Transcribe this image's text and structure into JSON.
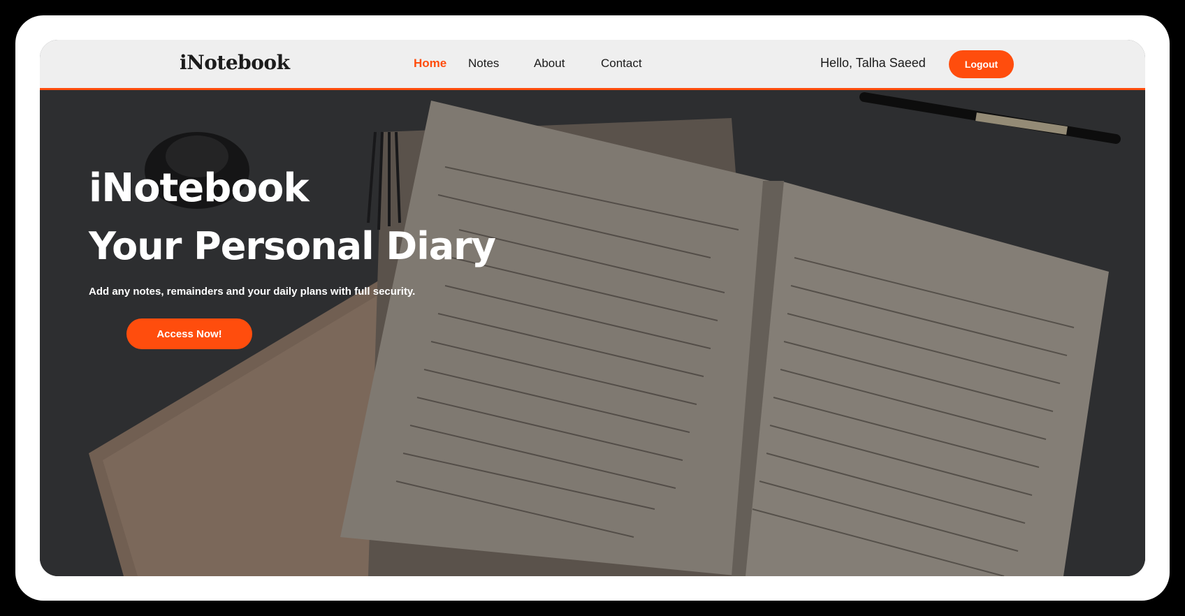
{
  "navbar": {
    "brand": "iNotebook",
    "links": [
      {
        "label": "Home",
        "active": true
      },
      {
        "label": "Notes",
        "active": false
      },
      {
        "label": "About",
        "active": false
      },
      {
        "label": "Contact",
        "active": false
      }
    ],
    "greeting": "Hello, Talha Saeed",
    "logout_label": "Logout"
  },
  "hero": {
    "title": "iNotebook",
    "subtitle": "Your Personal Diary",
    "description": "Add any notes, remainders and your daily plans with full security.",
    "cta_label": "Access Now!"
  },
  "colors": {
    "accent": "#ff4d0d",
    "navbar_bg": "#efefef",
    "frame_bg": "#ffffff",
    "outer_bg": "#000000"
  },
  "icons": {
    "hero_background": "notebook-diary-photo"
  }
}
